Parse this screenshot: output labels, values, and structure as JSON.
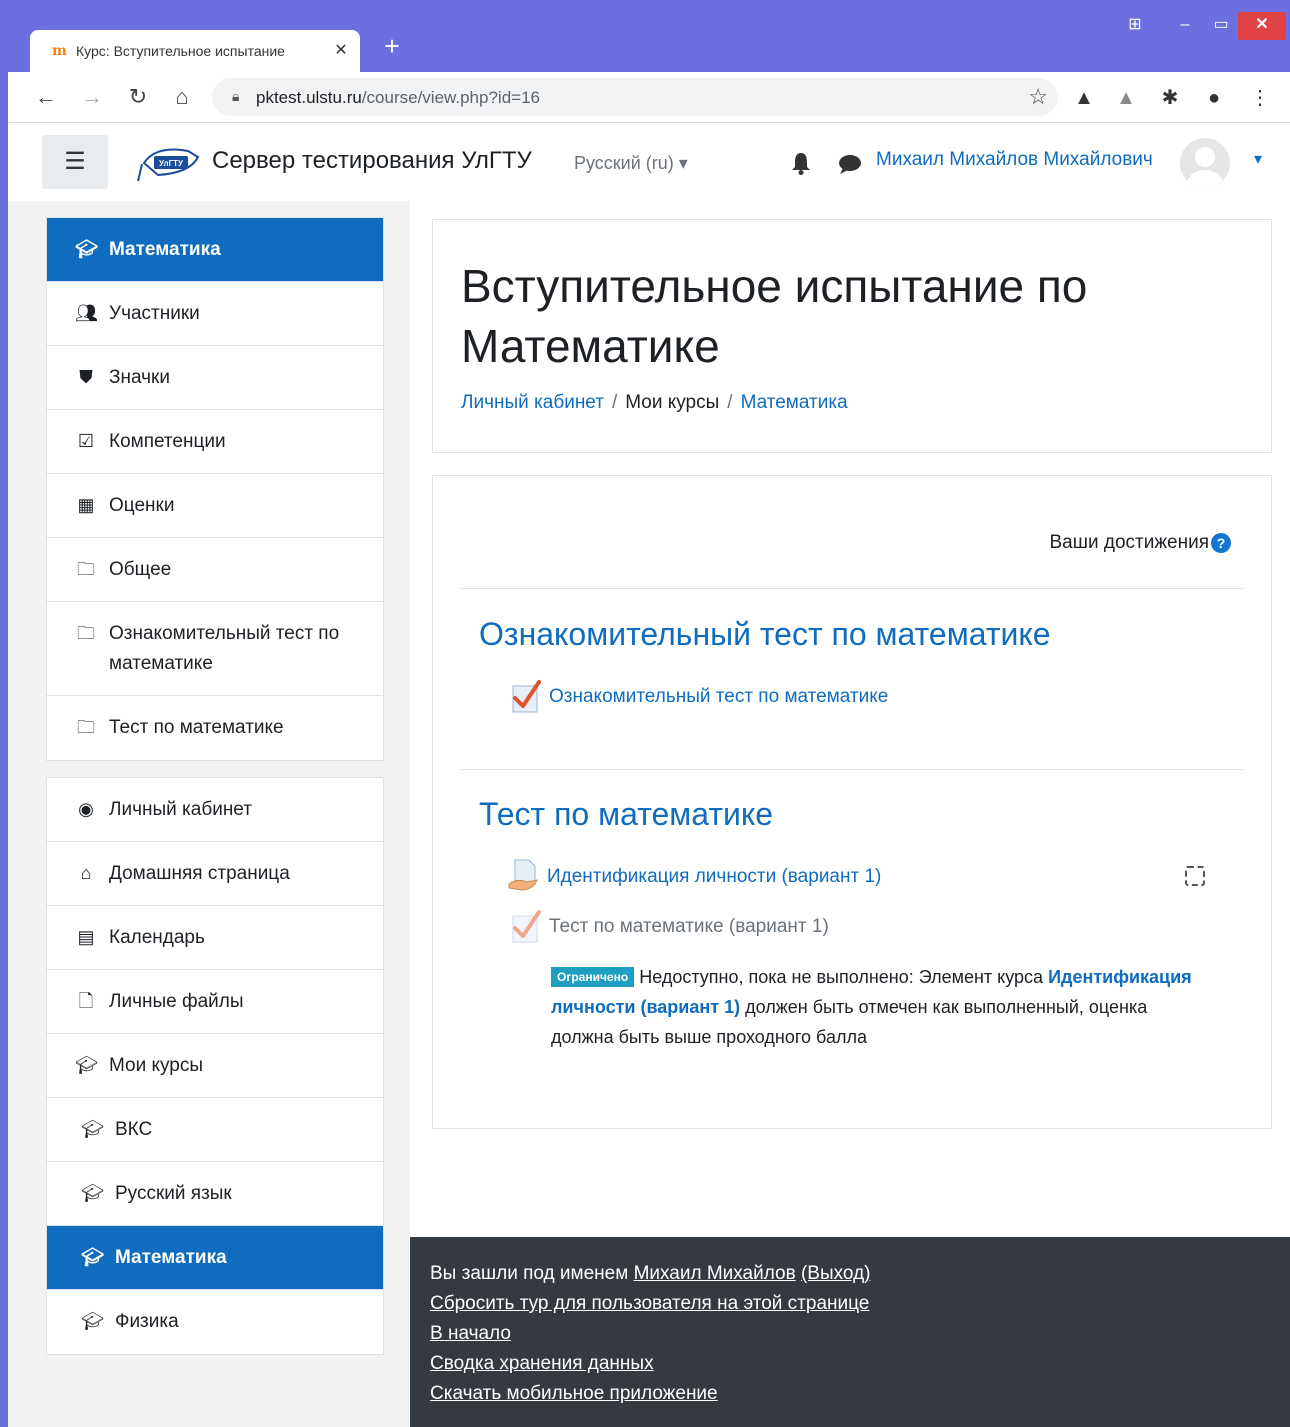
{
  "browser": {
    "tab_title": "Курс: Вступительное испытание",
    "url_host": "pktest.ulstu.ru",
    "url_path": "/course/view.php?id=16"
  },
  "navbar": {
    "site_name": "Сервер тестирования УлГТУ",
    "logo_text": "УлГТУ",
    "language": "Русский (ru)",
    "user_name": "Михаил Михайлов Михайлович"
  },
  "sidebar": {
    "course_items": [
      {
        "label": "Математика",
        "icon": "graduation-cap-icon",
        "active": true
      },
      {
        "label": "Участники",
        "icon": "users-icon"
      },
      {
        "label": "Значки",
        "icon": "shield-icon"
      },
      {
        "label": "Компетенции",
        "icon": "check-square-icon"
      },
      {
        "label": "Оценки",
        "icon": "table-icon"
      },
      {
        "label": "Общее",
        "icon": "folder-icon"
      },
      {
        "label": "Ознакомительный тест по математике",
        "icon": "folder-icon"
      },
      {
        "label": "Тест по математике",
        "icon": "folder-icon"
      }
    ],
    "site_items": [
      {
        "label": "Личный кабинет",
        "icon": "dashboard-icon"
      },
      {
        "label": "Домашняя страница",
        "icon": "home-icon"
      },
      {
        "label": "Календарь",
        "icon": "calendar-icon"
      },
      {
        "label": "Личные файлы",
        "icon": "file-icon"
      },
      {
        "label": "Мои курсы",
        "icon": "graduation-cap-icon"
      },
      {
        "label": "ВКС",
        "icon": "graduation-cap-icon"
      },
      {
        "label": "Русский язык",
        "icon": "graduation-cap-icon"
      },
      {
        "label": "Математика",
        "icon": "graduation-cap-icon",
        "active": true
      },
      {
        "label": "Физика",
        "icon": "graduation-cap-icon"
      }
    ]
  },
  "header": {
    "title": "Вступительное испытание по Математике",
    "breadcrumb": [
      "Личный кабинет",
      "Мои курсы",
      "Математика"
    ]
  },
  "content": {
    "achievements": "Ваши достижения",
    "sections": [
      {
        "title": "Ознакомительный тест по математике",
        "activities": [
          {
            "label": "Ознакомительный тест по математике",
            "icon": "quiz-icon"
          }
        ]
      },
      {
        "title": "Тест по математике",
        "activities": [
          {
            "label": "Идентификация личности (вариант 1)",
            "icon": "assignment-icon"
          },
          {
            "label": "Тест по математике (вариант 1)",
            "icon": "quiz-icon",
            "restricted": true
          }
        ]
      }
    ],
    "restriction": {
      "badge": "Ограничено",
      "text_before": "Недоступно, пока не выполнено: Элемент курса",
      "link": "Идентификация личности (вариант 1)",
      "text_after": "должен быть отмечен как выполненный, оценка должна быть выше проходного балла"
    }
  },
  "footer": {
    "logged_in_prefix": "Вы зашли под именем",
    "user_link": "Михаил Михайлов",
    "logout": "(Выход)",
    "reset_tour": "Сбросить тур для пользователя на этой странице",
    "home": "В начало",
    "data_retention": "Сводка хранения данных",
    "mobile_app": "Скачать мобильное приложение"
  },
  "colors": {
    "accent": "#0f6cbf",
    "window_frame": "#6b6fe0",
    "footer_bg": "#343a40",
    "badge": "#1e9fc1"
  }
}
